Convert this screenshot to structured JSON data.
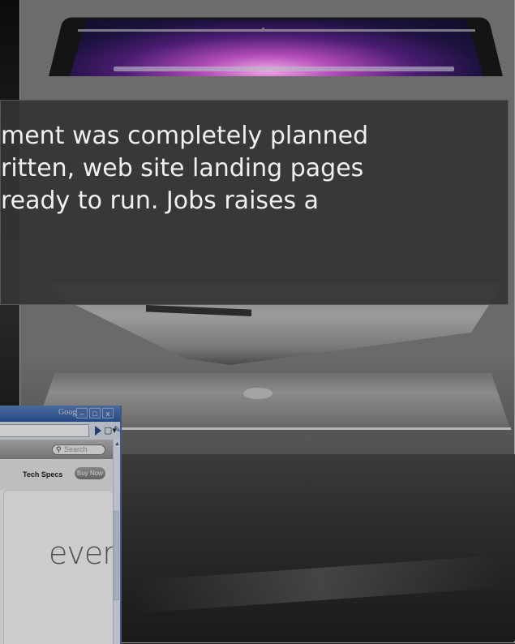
{
  "overlay": {
    "line1": "ment was completely planned",
    "line2": "ritten, web site landing pages",
    "line3": "ready to run. Jobs raises a"
  },
  "browser": {
    "title": "Google",
    "window_buttons": [
      "–",
      "□",
      "x"
    ],
    "search_placeholder": "Search",
    "tech_specs": "Tech Specs",
    "buy_now": "Buy Now",
    "hero_text": "ever."
  },
  "icons": {
    "go": "go-arrow-icon",
    "page": "page-icon",
    "wrench": "wrench-icon",
    "search": "search-icon"
  },
  "colors": {
    "overlay_bg": "#343434",
    "title_bar": "#2f5ba4"
  }
}
